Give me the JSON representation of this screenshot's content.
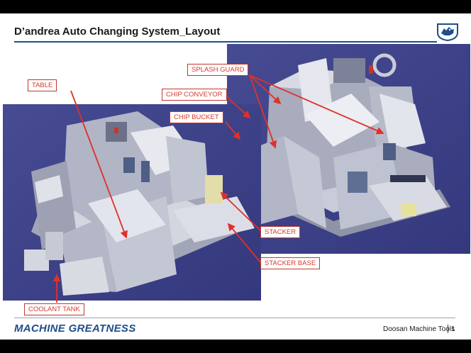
{
  "slide": {
    "title": "D’andrea Auto Changing System_Layout",
    "company": "Doosan Machine Tools",
    "page_number": "1",
    "brand_slogan": "MACHINE GREATNESS"
  },
  "labels": {
    "table": "TABLE",
    "splash_guard": "SPLASH GUARD",
    "chip_conveyor": "CHIP CONVEYOR",
    "chip_bucket": "CHIP BUCKET",
    "stacker": "STACKER",
    "stacker_base": "STACKER BASE",
    "coolant_tank": "COOLANT TANK"
  },
  "colors": {
    "accent": "#1d4e89",
    "callout_text": "#d63a2e",
    "arrow": "#e0302a",
    "render_background": "#3b3f86"
  },
  "icons": {
    "logo": "doosan-wolf-logo"
  }
}
